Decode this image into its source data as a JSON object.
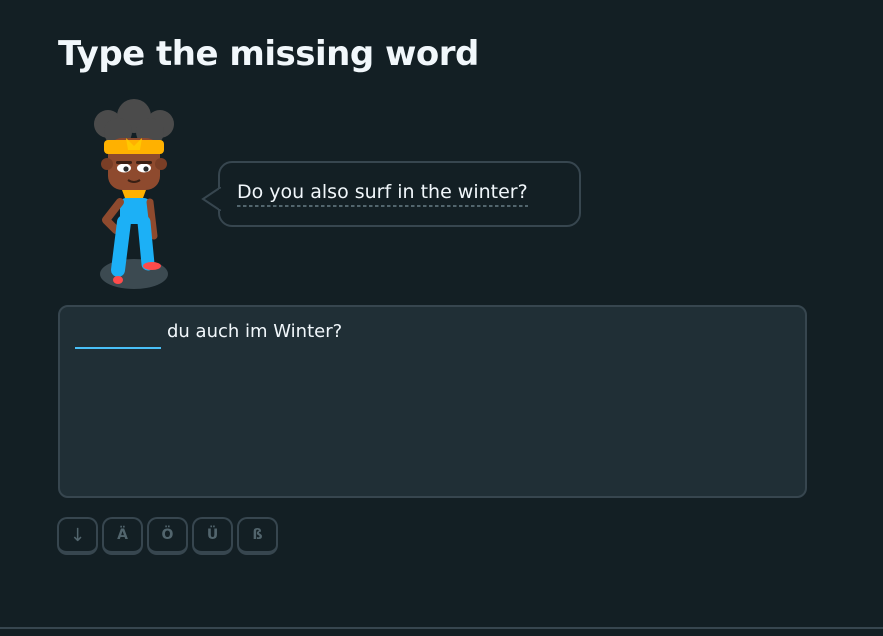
{
  "header": {
    "title": "Type the missing word"
  },
  "prompt": {
    "text": "Do you also surf in the winter?"
  },
  "answer": {
    "blank_value": "",
    "sentence_rest": "du auch im Winter?"
  },
  "keyboard": {
    "keys": [
      "↓",
      "Ä",
      "Ö",
      "Ü",
      "ß"
    ]
  },
  "colors": {
    "background": "#131f24",
    "panel": "#202f36",
    "border": "#37464f",
    "accent_blue": "#49c0f8",
    "muted": "#52656d"
  }
}
